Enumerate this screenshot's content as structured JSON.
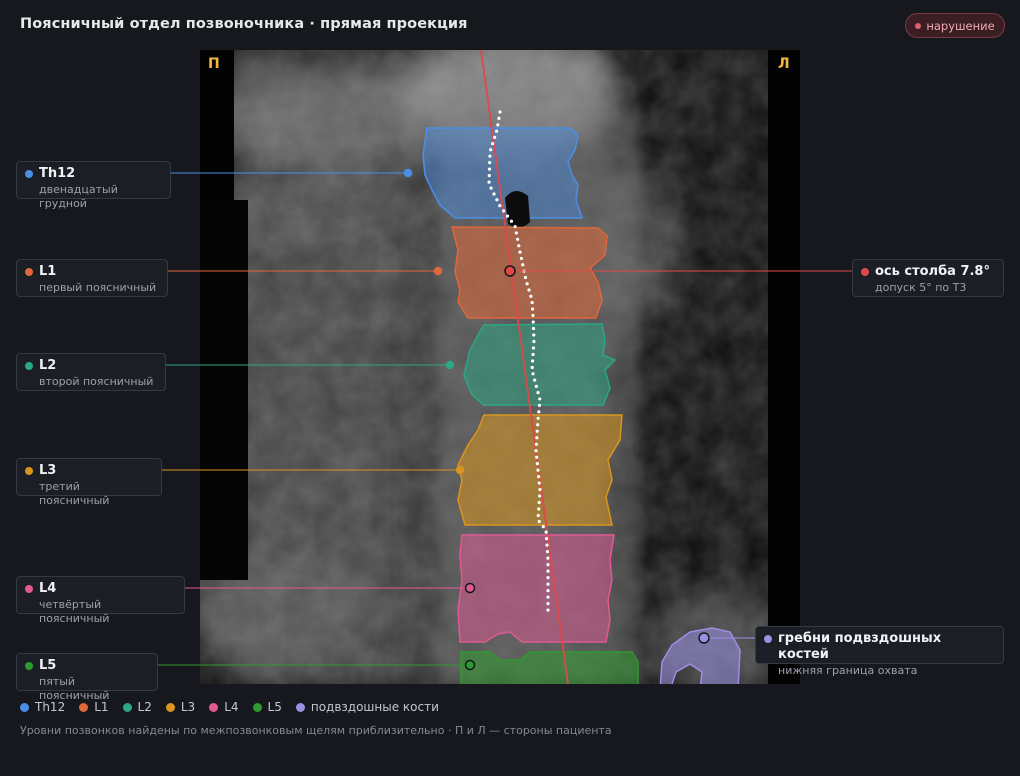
{
  "header": {
    "title": "Поясничный отдел позвоночника · прямая проекция",
    "status_badge": "нарушение"
  },
  "orientation": {
    "right_marker": "П",
    "left_marker": "Л"
  },
  "vertebrae": [
    {
      "code": "Th12",
      "name": "двенадцатый грудной",
      "color": "#4a8fe7"
    },
    {
      "code": "L1",
      "name": "первый поясничный",
      "color": "#e0673a"
    },
    {
      "code": "L2",
      "name": "второй поясничный",
      "color": "#2aa883"
    },
    {
      "code": "L3",
      "name": "третий поясничный",
      "color": "#d9951f"
    },
    {
      "code": "L4",
      "name": "четвёртый поясничный",
      "color": "#e05a92"
    },
    {
      "code": "L5",
      "name": "пятый поясничный",
      "color": "#2f9a2f"
    }
  ],
  "axis_callout": {
    "title": "ось столба 7.8°",
    "subtitle": "допуск 5° по Т3",
    "color": "#e04848"
  },
  "iliac_callout": {
    "title": "гребни подвздошных костей",
    "subtitle": "нижняя граница охвата",
    "color": "#9b8fe6"
  },
  "legend": [
    {
      "label": "Th12",
      "color": "#4a8fe7"
    },
    {
      "label": "L1",
      "color": "#e0673a"
    },
    {
      "label": "L2",
      "color": "#2aa883"
    },
    {
      "label": "L3",
      "color": "#d9951f"
    },
    {
      "label": "L4",
      "color": "#e05a92"
    },
    {
      "label": "L5",
      "color": "#2f9a2f"
    },
    {
      "label": "подвздошные кости",
      "color": "#9b8fe6"
    }
  ],
  "footnote": "Уровни позвонков найдены по межпозвонковым щелям приблизительно · П и Л — стороны пациента"
}
